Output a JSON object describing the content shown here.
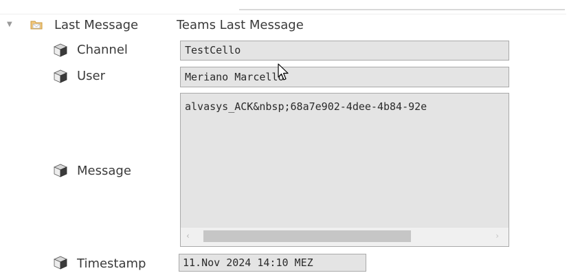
{
  "header": {
    "node_label": "Last Message",
    "node_value": "Teams Last Message",
    "icon": "envelope-folder-icon",
    "expander_icon": "triangle-down-icon"
  },
  "properties": {
    "channel": {
      "label": "Channel",
      "value": "TestCello",
      "icon": "cube-icon"
    },
    "user": {
      "label": "User",
      "value": "Meriano Marcello",
      "icon": "cube-icon"
    },
    "message": {
      "label": "Message",
      "value": "alvasys_ACK&nbsp;68a7e902-4dee-4b84-92e",
      "icon": "cube-icon"
    },
    "timestamp": {
      "label": "Timestamp",
      "value": "11.Nov 2024 14:10 MEZ",
      "icon": "cube-icon"
    }
  },
  "scrollbar": {
    "left_arrow": "‹",
    "right_arrow": "›"
  },
  "colors": {
    "field_background": "#e4e4e4",
    "field_border": "#a9a9a9",
    "text": "#3a3a3a",
    "folder_icon": "#f2c77b"
  }
}
